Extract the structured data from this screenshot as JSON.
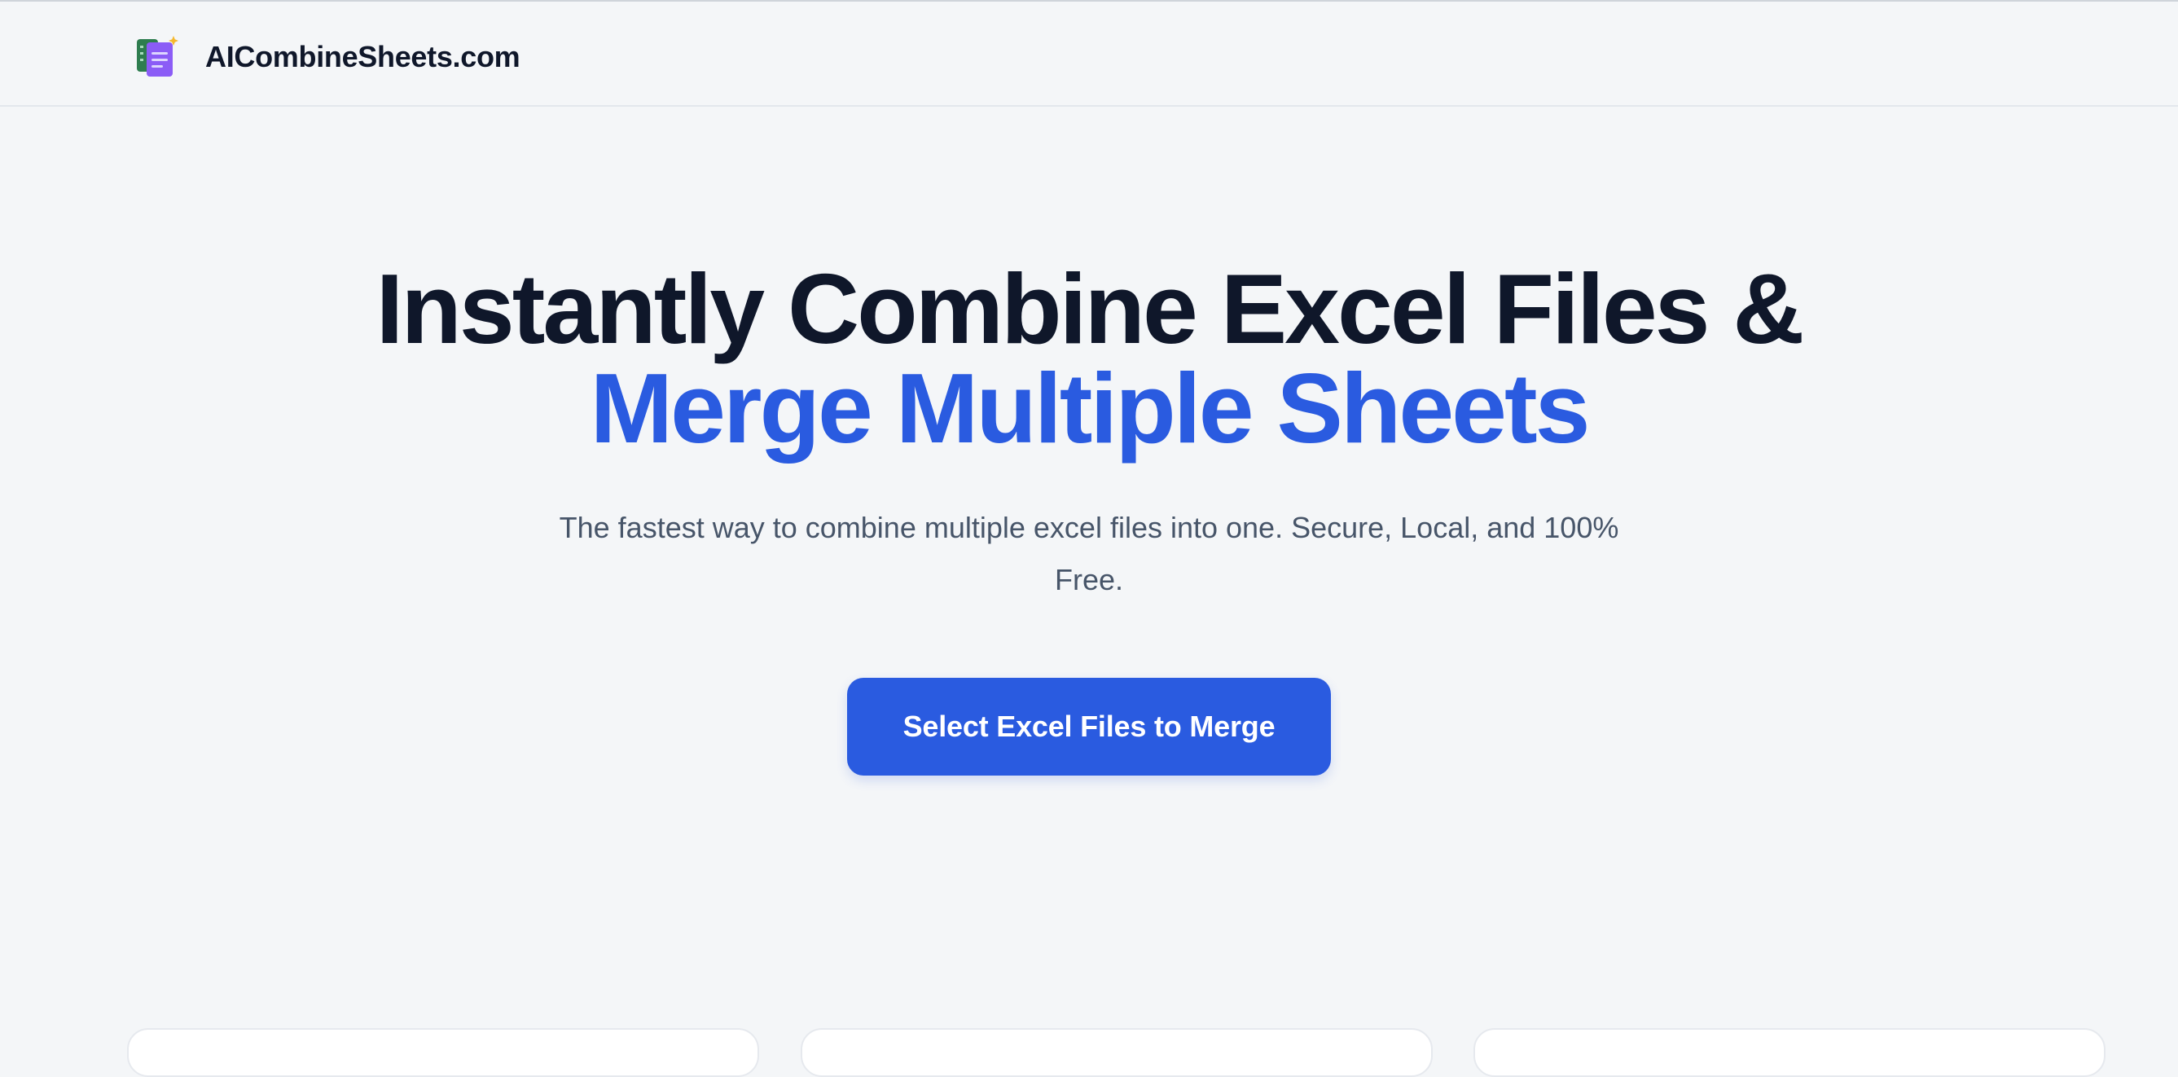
{
  "header": {
    "logo_icon": "spreadsheet-merge-logo-icon",
    "brand_name": "AICombineSheets.com"
  },
  "hero": {
    "title_line_1": "Instantly Combine Excel Files &",
    "title_line_2": "Merge Multiple Sheets",
    "subtitle": "The fastest way to combine multiple excel files into one. Secure, Local, and 100% Free.",
    "cta_label": "Select Excel Files to Merge"
  },
  "colors": {
    "page_background": "#f4f6f8",
    "heading_dark": "#0f172a",
    "accent_blue": "#2a5be0",
    "subtitle_gray": "#475569",
    "card_background": "#ffffff"
  }
}
